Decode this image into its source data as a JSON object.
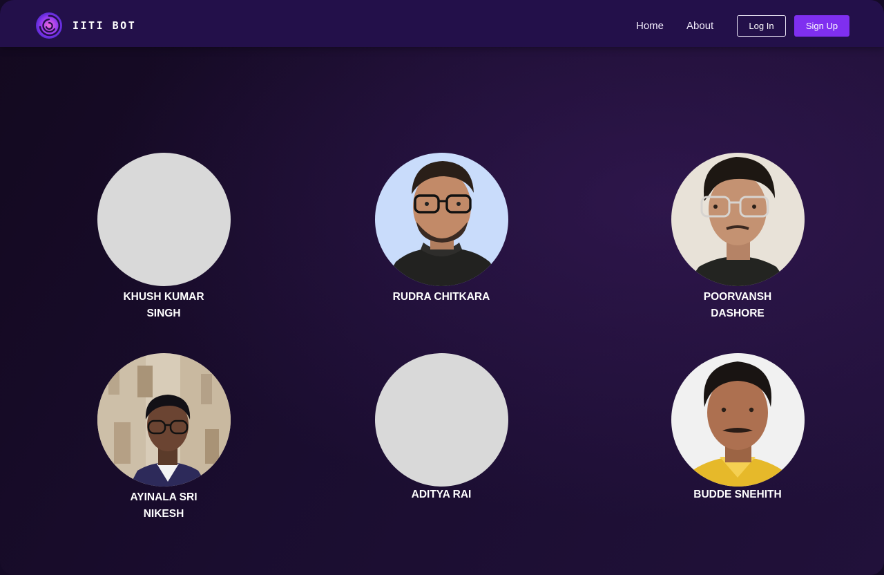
{
  "header": {
    "brand": "IITI BOT",
    "nav": {
      "home": "Home",
      "about": "About"
    },
    "login_label": "Log In",
    "signup_label": "Sign Up",
    "accent_color": "#7f2ff0"
  },
  "team": [
    {
      "name": "KHUSH KUMAR SINGH",
      "photo": "placeholder"
    },
    {
      "name": "RUDRA CHITKARA",
      "photo": "portrait"
    },
    {
      "name": "POORVANSH DASHORE",
      "photo": "portrait"
    },
    {
      "name": "AYINALA SRI NIKESH",
      "photo": "portrait"
    },
    {
      "name": "ADITYA RAI",
      "photo": "placeholder"
    },
    {
      "name": "BUDDE SNEHITH",
      "photo": "portrait"
    }
  ]
}
